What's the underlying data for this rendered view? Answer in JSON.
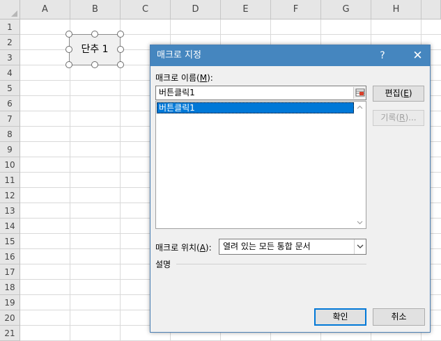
{
  "sheet": {
    "columns": [
      "A",
      "B",
      "C",
      "D",
      "E",
      "F",
      "G",
      "H"
    ],
    "rows": [
      "1",
      "2",
      "3",
      "4",
      "5",
      "6",
      "7",
      "8",
      "9",
      "10",
      "11",
      "12",
      "13",
      "14",
      "15",
      "16",
      "17",
      "18",
      "19",
      "20",
      "21"
    ],
    "form_button_label": "단추 1"
  },
  "dialog": {
    "title": "매크로 지정",
    "help": "?",
    "close": "✕",
    "macro_name_label_prefix": "매크로 이름(",
    "macro_name_label_key": "M",
    "macro_name_label_suffix": "):",
    "macro_name_value": "버튼클릭1",
    "macro_list": [
      "버튼클릭1"
    ],
    "edit_button_prefix": "편집(",
    "edit_button_key": "E",
    "edit_button_suffix": ")",
    "record_button_prefix": "기록(",
    "record_button_key": "R",
    "record_button_suffix": ")...",
    "location_label_prefix": "매크로 위치(",
    "location_label_key": "A",
    "location_label_suffix": "):",
    "location_value": "열려 있는 모든 통합 문서",
    "description_label": "설명",
    "ok_button": "확인",
    "cancel_button": "취소"
  },
  "colors": {
    "titlebar": "#4586bf",
    "selection": "#0078d7"
  }
}
